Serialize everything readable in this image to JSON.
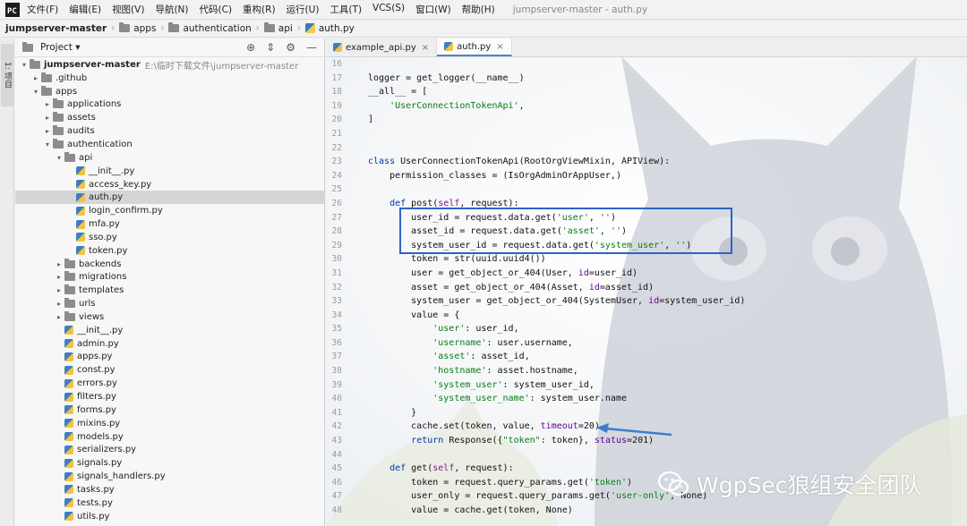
{
  "menubar": {
    "items": [
      "文件(F)",
      "编辑(E)",
      "视图(V)",
      "导航(N)",
      "代码(C)",
      "重构(R)",
      "运行(U)",
      "工具(T)",
      "VCS(S)",
      "窗口(W)",
      "帮助(H)"
    ],
    "window_title": "jumpserver-master - auth.py"
  },
  "breadcrumb": [
    "jumpserver-master",
    "apps",
    "authentication",
    "api",
    "auth.py"
  ],
  "left_strip": {
    "label": "1: 项目"
  },
  "project_panel": {
    "title": "Project ▾",
    "root_label": "jumpserver-master",
    "root_path": "E:\\临时下载文件\\jumpserver-master",
    "tree": [
      {
        "label": ".github",
        "type": "dir",
        "indent": 1,
        "arrow": "closed"
      },
      {
        "label": "apps",
        "type": "dir",
        "indent": 1,
        "arrow": "open"
      },
      {
        "label": "applications",
        "type": "dir",
        "indent": 2,
        "arrow": "closed"
      },
      {
        "label": "assets",
        "type": "dir",
        "indent": 2,
        "arrow": "closed"
      },
      {
        "label": "audits",
        "type": "dir",
        "indent": 2,
        "arrow": "closed"
      },
      {
        "label": "authentication",
        "type": "dir",
        "indent": 2,
        "arrow": "open"
      },
      {
        "label": "api",
        "type": "dir",
        "indent": 3,
        "arrow": "open"
      },
      {
        "label": "__init__.py",
        "type": "py",
        "indent": 4,
        "arrow": ""
      },
      {
        "label": "access_key.py",
        "type": "py",
        "indent": 4,
        "arrow": ""
      },
      {
        "label": "auth.py",
        "type": "py",
        "indent": 4,
        "arrow": "",
        "selected": true
      },
      {
        "label": "login_confirm.py",
        "type": "py",
        "indent": 4,
        "arrow": ""
      },
      {
        "label": "mfa.py",
        "type": "py",
        "indent": 4,
        "arrow": ""
      },
      {
        "label": "sso.py",
        "type": "py",
        "indent": 4,
        "arrow": ""
      },
      {
        "label": "token.py",
        "type": "py",
        "indent": 4,
        "arrow": ""
      },
      {
        "label": "backends",
        "type": "dir",
        "indent": 3,
        "arrow": "closed"
      },
      {
        "label": "migrations",
        "type": "dir",
        "indent": 3,
        "arrow": "closed"
      },
      {
        "label": "templates",
        "type": "dir",
        "indent": 3,
        "arrow": "closed"
      },
      {
        "label": "urls",
        "type": "dir",
        "indent": 3,
        "arrow": "closed"
      },
      {
        "label": "views",
        "type": "dir",
        "indent": 3,
        "arrow": "closed"
      },
      {
        "label": "__init__.py",
        "type": "py",
        "indent": 3,
        "arrow": ""
      },
      {
        "label": "admin.py",
        "type": "py",
        "indent": 3,
        "arrow": ""
      },
      {
        "label": "apps.py",
        "type": "py",
        "indent": 3,
        "arrow": ""
      },
      {
        "label": "const.py",
        "type": "py",
        "indent": 3,
        "arrow": ""
      },
      {
        "label": "errors.py",
        "type": "py",
        "indent": 3,
        "arrow": ""
      },
      {
        "label": "filters.py",
        "type": "py",
        "indent": 3,
        "arrow": ""
      },
      {
        "label": "forms.py",
        "type": "py",
        "indent": 3,
        "arrow": ""
      },
      {
        "label": "mixins.py",
        "type": "py",
        "indent": 3,
        "arrow": ""
      },
      {
        "label": "models.py",
        "type": "py",
        "indent": 3,
        "arrow": ""
      },
      {
        "label": "serializers.py",
        "type": "py",
        "indent": 3,
        "arrow": ""
      },
      {
        "label": "signals.py",
        "type": "py",
        "indent": 3,
        "arrow": ""
      },
      {
        "label": "signals_handlers.py",
        "type": "py",
        "indent": 3,
        "arrow": ""
      },
      {
        "label": "tasks.py",
        "type": "py",
        "indent": 3,
        "arrow": ""
      },
      {
        "label": "tests.py",
        "type": "py",
        "indent": 3,
        "arrow": ""
      },
      {
        "label": "utils.py",
        "type": "py",
        "indent": 3,
        "arrow": ""
      }
    ]
  },
  "tabs": [
    {
      "label": "example_api.py",
      "active": false
    },
    {
      "label": "auth.py",
      "active": true
    }
  ],
  "code_lines": [
    {
      "n": "16",
      "html": ""
    },
    {
      "n": "17",
      "html": "logger = get_logger(__name__)"
    },
    {
      "n": "18",
      "html": "__all__ = ["
    },
    {
      "n": "19",
      "html": "    <span class='str'>'UserConnectionTokenApi'</span>,"
    },
    {
      "n": "20",
      "html": "]"
    },
    {
      "n": "21",
      "html": ""
    },
    {
      "n": "22",
      "html": ""
    },
    {
      "n": "23",
      "html": "<span class='kw'>class</span> UserConnectionTokenApi(RootOrgViewMixin, APIView):"
    },
    {
      "n": "24",
      "html": "    permission_classes = (IsOrgAdminOrAppUser,)"
    },
    {
      "n": "25",
      "html": ""
    },
    {
      "n": "26",
      "html": "    <span class='kw'>def</span> post(<span class='dec'>self</span>, request):"
    },
    {
      "n": "27",
      "html": "        user_id = request.data.get(<span class='str'>'user'</span>, <span class='str'>''</span>)"
    },
    {
      "n": "28",
      "html": "        asset_id = request.data.get(<span class='str'>'asset'</span>, <span class='str'>''</span>)"
    },
    {
      "n": "29",
      "html": "        system_user_id = request.data.get(<span class='str'>'system_user'</span>, <span class='str'>''</span>)"
    },
    {
      "n": "30",
      "html": "        token = str(uuid.uuid4())"
    },
    {
      "n": "31",
      "html": "        user = get_object_or_404(User, <span class='kwarg'>id</span>=user_id)"
    },
    {
      "n": "32",
      "html": "        asset = get_object_or_404(Asset, <span class='kwarg'>id</span>=asset_id)"
    },
    {
      "n": "33",
      "html": "        system_user = get_object_or_404(SystemUser, <span class='kwarg'>id</span>=system_user_id)"
    },
    {
      "n": "34",
      "html": "        value = {"
    },
    {
      "n": "35",
      "html": "            <span class='str'>'user'</span>: user_id,"
    },
    {
      "n": "36",
      "html": "            <span class='str'>'username'</span>: user.username,"
    },
    {
      "n": "37",
      "html": "            <span class='str'>'asset'</span>: asset_id,"
    },
    {
      "n": "38",
      "html": "            <span class='str'>'hostname'</span>: asset.hostname,"
    },
    {
      "n": "39",
      "html": "            <span class='str'>'system_user'</span>: system_user_id,"
    },
    {
      "n": "40",
      "html": "            <span class='str'>'system_user_name'</span>: system_user.name"
    },
    {
      "n": "41",
      "html": "        }"
    },
    {
      "n": "42",
      "html": "        cache.set(token, value, <span class='kwarg'>timeout</span>=20)"
    },
    {
      "n": "43",
      "html": "        <span class='kw'>return</span> Response({<span class='str'>\"token\"</span>: token}, <span class='kwarg'>status</span>=201)"
    },
    {
      "n": "44",
      "html": ""
    },
    {
      "n": "45",
      "html": "    <span class='kw'>def</span> get(<span class='dec'>self</span>, request):"
    },
    {
      "n": "46",
      "html": "        token = request.query_params.get(<span class='str'>'token'</span>)"
    },
    {
      "n": "47",
      "html": "        user_only = request.query_params.get(<span class='str'>'user-only'</span>, None)"
    },
    {
      "n": "48",
      "html": "        value = cache.get(token, None)"
    }
  ],
  "watermark": {
    "text": "WgpSec狼组安全团队"
  },
  "colors": {
    "highlight_box": "#2f62c9",
    "arrow": "#3a7fd0"
  }
}
